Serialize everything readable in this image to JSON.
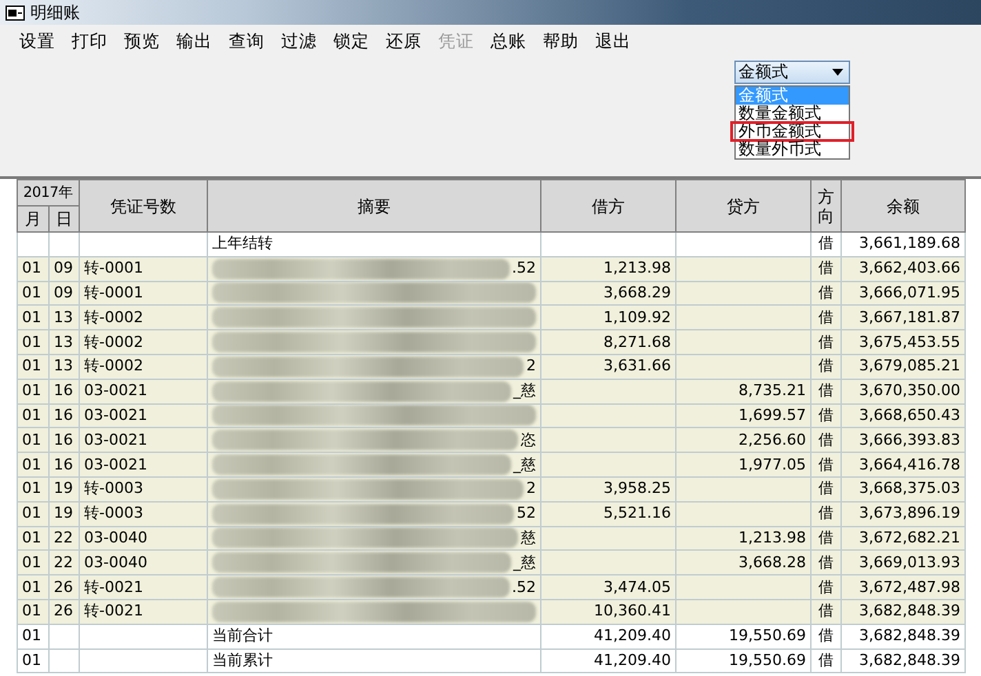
{
  "window": {
    "title": "明细账"
  },
  "menu": [
    {
      "label": "设置",
      "disabled": false
    },
    {
      "label": "打印",
      "disabled": false
    },
    {
      "label": "预览",
      "disabled": false
    },
    {
      "label": "输出",
      "disabled": false
    },
    {
      "label": "查询",
      "disabled": false
    },
    {
      "label": "过滤",
      "disabled": false
    },
    {
      "label": "锁定",
      "disabled": false
    },
    {
      "label": "还原",
      "disabled": false
    },
    {
      "label": "凭证",
      "disabled": true
    },
    {
      "label": "总账",
      "disabled": false
    },
    {
      "label": "帮助",
      "disabled": false
    },
    {
      "label": "退出",
      "disabled": false
    }
  ],
  "format_dropdown": {
    "value": "金额式",
    "expanded": true,
    "options": [
      {
        "label": "金额式",
        "selected": true,
        "highlighted": false
      },
      {
        "label": "数量金额式",
        "selected": false,
        "highlighted": false
      },
      {
        "label": "外币金额式",
        "selected": false,
        "highlighted": true
      },
      {
        "label": "数量外币式",
        "selected": false,
        "highlighted": false
      }
    ]
  },
  "table": {
    "year_header": "2017年",
    "columns": [
      "月",
      "日",
      "凭证号数",
      "摘要",
      "借方",
      "贷方",
      "方向",
      "余额"
    ],
    "rows": [
      {
        "kind": "plain",
        "month": "",
        "day": "",
        "voucher": "",
        "summary": "上年结转",
        "redacted": false,
        "debit": "",
        "credit": "",
        "direction": "借",
        "balance": "3,661,189.68"
      },
      {
        "kind": "entry",
        "month": "01",
        "day": "09",
        "voucher": "转-0001",
        "summary": ".52",
        "redacted": true,
        "debit": "1,213.98",
        "credit": "",
        "direction": "借",
        "balance": "3,662,403.66"
      },
      {
        "kind": "entry",
        "month": "01",
        "day": "09",
        "voucher": "转-0001",
        "summary": "",
        "redacted": true,
        "debit": "3,668.29",
        "credit": "",
        "direction": "借",
        "balance": "3,666,071.95"
      },
      {
        "kind": "entry",
        "month": "01",
        "day": "13",
        "voucher": "转-0002",
        "summary": "",
        "redacted": true,
        "debit": "1,109.92",
        "credit": "",
        "direction": "借",
        "balance": "3,667,181.87"
      },
      {
        "kind": "entry",
        "month": "01",
        "day": "13",
        "voucher": "转-0002",
        "summary": "",
        "redacted": true,
        "debit": "8,271.68",
        "credit": "",
        "direction": "借",
        "balance": "3,675,453.55"
      },
      {
        "kind": "entry",
        "month": "01",
        "day": "13",
        "voucher": "转-0002",
        "summary": "2",
        "redacted": true,
        "debit": "3,631.66",
        "credit": "",
        "direction": "借",
        "balance": "3,679,085.21"
      },
      {
        "kind": "entry",
        "month": "01",
        "day": "16",
        "voucher": "03-0021",
        "summary": "_慈",
        "redacted": true,
        "debit": "",
        "credit": "8,735.21",
        "direction": "借",
        "balance": "3,670,350.00"
      },
      {
        "kind": "entry",
        "month": "01",
        "day": "16",
        "voucher": "03-0021",
        "summary": "",
        "redacted": true,
        "debit": "",
        "credit": "1,699.57",
        "direction": "借",
        "balance": "3,668,650.43"
      },
      {
        "kind": "entry",
        "month": "01",
        "day": "16",
        "voucher": "03-0021",
        "summary": "恣",
        "redacted": true,
        "debit": "",
        "credit": "2,256.60",
        "direction": "借",
        "balance": "3,666,393.83"
      },
      {
        "kind": "entry",
        "month": "01",
        "day": "16",
        "voucher": "03-0021",
        "summary": "_慈",
        "redacted": true,
        "debit": "",
        "credit": "1,977.05",
        "direction": "借",
        "balance": "3,664,416.78"
      },
      {
        "kind": "entry",
        "month": "01",
        "day": "19",
        "voucher": "转-0003",
        "summary": "2",
        "redacted": true,
        "debit": "3,958.25",
        "credit": "",
        "direction": "借",
        "balance": "3,668,375.03"
      },
      {
        "kind": "entry",
        "month": "01",
        "day": "19",
        "voucher": "转-0003",
        "summary": "52",
        "redacted": true,
        "debit": "5,521.16",
        "credit": "",
        "direction": "借",
        "balance": "3,673,896.19"
      },
      {
        "kind": "entry",
        "month": "01",
        "day": "22",
        "voucher": "03-0040",
        "summary": "慈",
        "redacted": true,
        "debit": "",
        "credit": "1,213.98",
        "direction": "借",
        "balance": "3,672,682.21"
      },
      {
        "kind": "entry",
        "month": "01",
        "day": "22",
        "voucher": "03-0040",
        "summary": "_慈",
        "redacted": true,
        "debit": "",
        "credit": "3,668.28",
        "direction": "借",
        "balance": "3,669,013.93"
      },
      {
        "kind": "entry",
        "month": "01",
        "day": "26",
        "voucher": "转-0021",
        "summary": ".52",
        "redacted": true,
        "debit": "3,474.05",
        "credit": "",
        "direction": "借",
        "balance": "3,672,487.98"
      },
      {
        "kind": "entry",
        "month": "01",
        "day": "26",
        "voucher": "转-0021",
        "summary": "",
        "redacted": true,
        "debit": "10,360.41",
        "credit": "",
        "direction": "借",
        "balance": "3,682,848.39"
      },
      {
        "kind": "plain",
        "month": "01",
        "day": "",
        "voucher": "",
        "summary": "当前合计",
        "redacted": false,
        "debit": "41,209.40",
        "credit": "19,550.69",
        "direction": "借",
        "balance": "3,682,848.39"
      },
      {
        "kind": "plain",
        "month": "01",
        "day": "",
        "voucher": "",
        "summary": "当前累计",
        "redacted": false,
        "debit": "41,209.40",
        "credit": "19,550.69",
        "direction": "借",
        "balance": "3,682,848.39"
      }
    ]
  }
}
